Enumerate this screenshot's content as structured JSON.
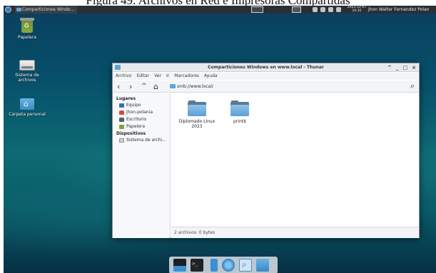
{
  "caption": "Figura 49. Archivos en Red e Impresoras Compartidas",
  "panel": {
    "task_label": "Comparticiones Windo...",
    "clock_date": "2023-12-07",
    "clock_time": "10:35",
    "user_name": "Jhon Walter Fernandez Polan"
  },
  "desktop_icons": [
    {
      "label": "Papelera",
      "icon": "trash-icon"
    },
    {
      "label": "Sistema de archivos",
      "icon": "drive-icon"
    },
    {
      "label": "Carpeta personal",
      "icon": "home-folder-icon"
    }
  ],
  "window": {
    "title": "Comparticiones Windows en www.local - Thunar",
    "controls": [
      "^",
      "_",
      "□",
      "×"
    ],
    "menu": [
      "Archivo",
      "Editar",
      "Ver",
      "Ir",
      "Marcadores",
      "Ayuda"
    ],
    "nav": {
      "back": "‹",
      "forward": "›",
      "up": "^",
      "home": "⌂",
      "search": "⌕"
    },
    "location": "smb://www.local/",
    "sidebar": {
      "places_header": "Lugares",
      "places": [
        "Equipo",
        "jhon-polania",
        "Escritorio",
        "Papelera"
      ],
      "devices_header": "Dispositivos",
      "devices": [
        "Sistema de archi..."
      ]
    },
    "files": [
      {
        "name": "Diplomado Linux 2023"
      },
      {
        "name": "print$"
      }
    ],
    "status": "2 archivos: 0 bytes"
  }
}
